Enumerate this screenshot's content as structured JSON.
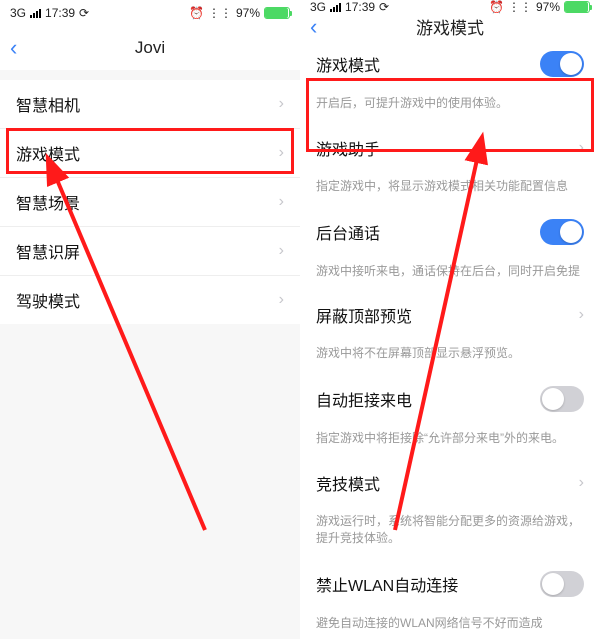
{
  "status": {
    "signal_label": "3G",
    "time": "17:39",
    "loop_icon": "⟳",
    "alarm_icon": "⏰",
    "wifi_icon": "⋮⋮",
    "battery_pct": "97%"
  },
  "left": {
    "title": "Jovi",
    "items": [
      {
        "label": "智慧相机"
      },
      {
        "label": "游戏模式"
      },
      {
        "label": "智慧场景"
      },
      {
        "label": "智慧识屏"
      },
      {
        "label": "驾驶模式"
      }
    ]
  },
  "right": {
    "title": "游戏模式",
    "sections": [
      {
        "title": "游戏模式",
        "sub": "开启后，可提升游戏中的使用体验。",
        "type": "toggle",
        "on": true
      },
      {
        "title": "游戏助手",
        "sub": "指定游戏中，将显示游戏模式相关功能配置信息",
        "type": "nav"
      },
      {
        "title": "后台通话",
        "sub": "游戏中接听来电，通话保持在后台，同时开启免提",
        "type": "toggle",
        "on": true
      },
      {
        "title": "屏蔽顶部预览",
        "sub": "游戏中将不在屏幕顶部显示悬浮预览。",
        "type": "nav"
      },
      {
        "title": "自动拒接来电",
        "sub": "指定游戏中将拒接除“允许部分来电”外的来电。",
        "type": "toggle",
        "on": false
      },
      {
        "title": "竞技模式",
        "sub": "游戏运行时，系统将智能分配更多的资源给游戏，提升竞技体验。",
        "type": "nav"
      },
      {
        "title": "禁止WLAN自动连接",
        "sub": "避免自动连接的WLAN网络信号不好而造成",
        "type": "toggle",
        "on": false
      }
    ]
  }
}
